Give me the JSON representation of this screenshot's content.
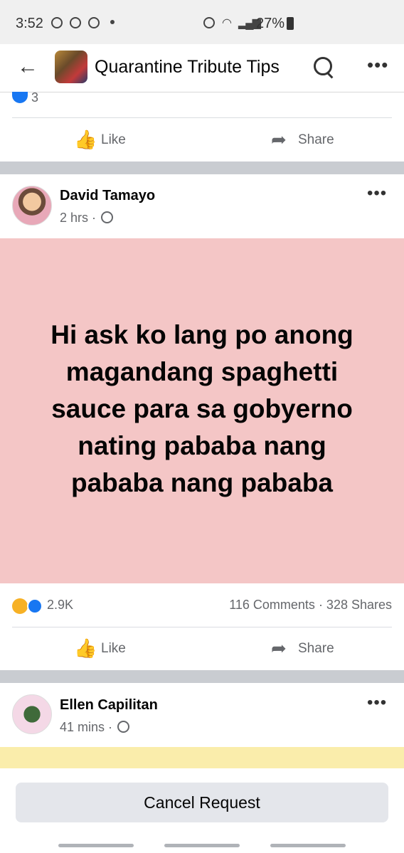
{
  "status_bar": {
    "time": "3:52",
    "battery": "27%",
    "icons": [
      "messenger-icon",
      "viber-icon",
      "viber-icon",
      "alarm-icon",
      "wifi-icon",
      "signal-icon",
      "battery-icon"
    ]
  },
  "header": {
    "title": "Quarantine Tribute Tips",
    "back_icon": "←",
    "more_icon": "•••"
  },
  "post_prev": {
    "reaction_count": "3",
    "like_label": "Like",
    "share_label": "Share"
  },
  "post_main": {
    "author": "David Tamayo",
    "time": "2 hrs · ",
    "more_icon": "•••",
    "text": "Hi ask ko lang po anong magandang spaghetti sauce para sa gobyerno nating pababa nang pababa nang pababa",
    "background_color": "#f4c6c6",
    "reaction_count": "2.9K",
    "comments_shares": "116 Comments · 328 Shares",
    "like_label": "Like",
    "share_label": "Share"
  },
  "post_next": {
    "author": "Ellen Capilitan",
    "time": "41 mins · ",
    "more_icon": "•••"
  },
  "bottom": {
    "cancel_label": "Cancel Request"
  },
  "icons": {
    "thumb": "👍",
    "share": "➦"
  },
  "colors": {
    "accent": "#1877f2",
    "divider_gap": "#c9ccd1",
    "post_background": "#f4c6c6",
    "next_post_background": "#faedab"
  }
}
